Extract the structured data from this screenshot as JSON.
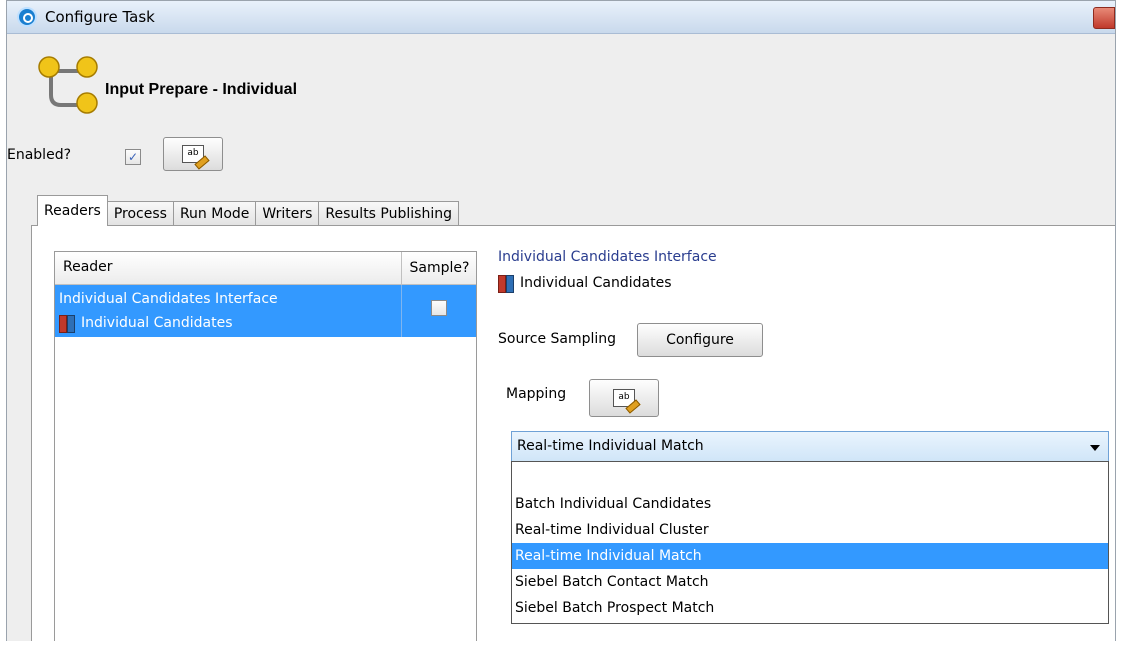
{
  "window": {
    "title": "Configure Task"
  },
  "task": {
    "name": "Input Prepare - Individual"
  },
  "enabled": {
    "label": "Enabled?",
    "checked": true,
    "check_glyph": "✓"
  },
  "tabs": [
    {
      "label": "Readers",
      "active": true
    },
    {
      "label": "Process",
      "active": false
    },
    {
      "label": "Run Mode",
      "active": false
    },
    {
      "label": "Writers",
      "active": false
    },
    {
      "label": "Results Publishing",
      "active": false
    }
  ],
  "reader_table": {
    "columns": [
      "Reader",
      "Sample?"
    ],
    "rows": [
      {
        "interface": "Individual Candidates Interface",
        "name": "Individual Candidates",
        "sample": false,
        "selected": true
      }
    ]
  },
  "details": {
    "interface_name": "Individual Candidates Interface",
    "reader_name": "Individual Candidates",
    "source_sampling_label": "Source Sampling",
    "configure_button": "Configure",
    "mapping_label": "Mapping"
  },
  "mapping_dropdown": {
    "selected": "Real-time Individual Match",
    "options": [
      "",
      "Batch Individual Candidates",
      "Real-time Individual Cluster",
      "Real-time Individual Match",
      "Siebel Batch Contact Match",
      "Siebel Batch Prospect Match"
    ],
    "highlighted_index": 3
  },
  "icons": {
    "app": "app-icon",
    "task": "task-flow-icon",
    "edit": "edit-icon",
    "data_store": "data-store-icon",
    "dropdown_arrow": "chevron-down-icon"
  },
  "colors": {
    "selection": "#3399ff",
    "link": "#2a3d8f"
  }
}
